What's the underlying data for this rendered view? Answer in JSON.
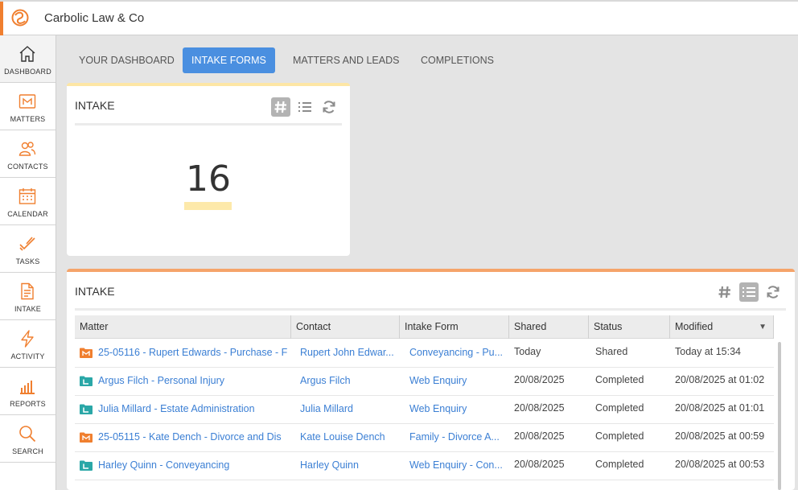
{
  "app": {
    "title": "Carbolic Law & Co"
  },
  "sidebar": {
    "items": [
      {
        "label": "DASHBOARD",
        "icon": "house-icon"
      },
      {
        "label": "MATTERS",
        "icon": "matters-folder-icon"
      },
      {
        "label": "CONTACTS",
        "icon": "people-icon"
      },
      {
        "label": "CALENDAR",
        "icon": "calendar-icon"
      },
      {
        "label": "TASKS",
        "icon": "checkmark-icon"
      },
      {
        "label": "INTAKE",
        "icon": "document-icon"
      },
      {
        "label": "ACTIVITY",
        "icon": "lightning-icon"
      },
      {
        "label": "REPORTS",
        "icon": "bar-chart-icon"
      },
      {
        "label": "SEARCH",
        "icon": "magnifier-icon"
      }
    ]
  },
  "tabs": [
    {
      "label": "YOUR DASHBOARD",
      "active": false
    },
    {
      "label": "INTAKE FORMS",
      "active": true
    },
    {
      "label": "MATTERS AND LEADS",
      "active": false
    },
    {
      "label": "COMPLETIONS",
      "active": false
    }
  ],
  "widget_count": {
    "title": "INTAKE",
    "value": "16"
  },
  "widget_list": {
    "title": "INTAKE",
    "columns": [
      "Matter",
      "Contact",
      "Intake Form",
      "Shared",
      "Status",
      "Modified"
    ],
    "rows": [
      {
        "matter": "25-05116 - Rupert Edwards - Purchase - F",
        "matter_icon": "orange",
        "contact": "Rupert John Edwar...",
        "form": "Conveyancing - Pu...",
        "shared": "Today",
        "status": "Shared",
        "modified": "Today at 15:34"
      },
      {
        "matter": "Argus Filch - Personal Injury",
        "matter_icon": "teal",
        "contact": "Argus Filch",
        "form": "Web Enquiry",
        "shared": "20/08/2025",
        "status": "Completed",
        "modified": "20/08/2025 at 01:02"
      },
      {
        "matter": "Julia Millard - Estate Administration",
        "matter_icon": "teal",
        "contact": "Julia Millard",
        "form": "Web Enquiry",
        "shared": "20/08/2025",
        "status": "Completed",
        "modified": "20/08/2025 at 01:01"
      },
      {
        "matter": "25-05115 - Kate Dench - Divorce and Dis",
        "matter_icon": "orange",
        "contact": "Kate Louise Dench",
        "form": "Family - Divorce A...",
        "shared": "20/08/2025",
        "status": "Completed",
        "modified": "20/08/2025 at 00:59"
      },
      {
        "matter": "Harley Quinn - Conveyancing",
        "matter_icon": "teal",
        "contact": "Harley Quinn",
        "form": "Web Enquiry - Con...",
        "shared": "20/08/2025",
        "status": "Completed",
        "modified": "20/08/2025 at 00:53"
      }
    ]
  },
  "colors": {
    "accent": "#f07f2f",
    "tab_active": "#4a8fe0",
    "link": "#3b7fd4",
    "teal_icon": "#2aa7a7",
    "orange_icon": "#f07f2f"
  }
}
